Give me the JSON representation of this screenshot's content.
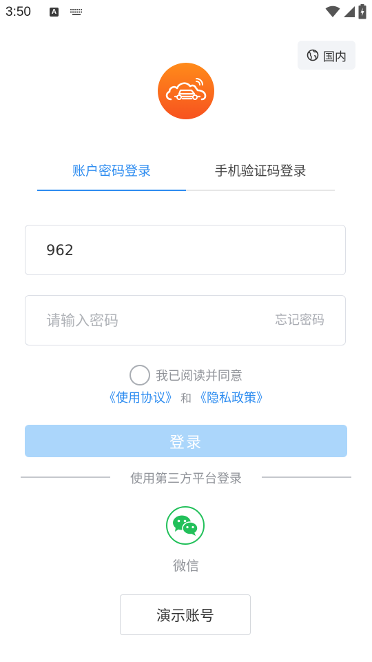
{
  "status_bar": {
    "time": "3:50",
    "a_indicator": "A",
    "icons": [
      "a-notification-icon",
      "keyboard-icon",
      "wifi-icon",
      "signal-icon",
      "battery-icon"
    ]
  },
  "header": {
    "region_label": "国内",
    "region_icon": "globe-icon",
    "logo_icon": "cloud-car-icon"
  },
  "tabs": [
    {
      "label": "账户密码登录",
      "active": true
    },
    {
      "label": "手机验证码登录",
      "active": false
    }
  ],
  "form": {
    "account_value": "962",
    "account_placeholder": "",
    "password_value": "",
    "password_placeholder": "请输入密码",
    "forgot_label": "忘记密码"
  },
  "agreement": {
    "text": "我已阅读并同意",
    "terms_link": "《使用协议》",
    "and": "和",
    "privacy_link": "《隐私政策》",
    "checked": false
  },
  "login_button": "登录",
  "third_party": {
    "divider_text": "使用第三方平台登录",
    "wechat_label": "微信",
    "wechat_icon": "wechat-icon"
  },
  "demo_button": "演示账号",
  "colors": {
    "accent": "#2d8cf0",
    "login_button_disabled": "#abd6fb",
    "logo_gradient_top": "#ff8b1a",
    "logo_gradient_bottom": "#f7521f",
    "wechat_green": "#22c05a"
  }
}
